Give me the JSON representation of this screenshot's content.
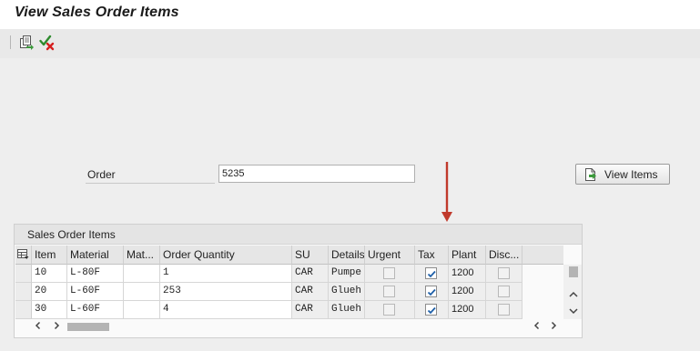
{
  "window": {
    "title": "View Sales Order Items"
  },
  "toolbar": {
    "icons": [
      "copy-document-icon",
      "check-cancel-icon"
    ]
  },
  "form": {
    "order_label": "Order",
    "order_value": "5235",
    "view_button_label": "View Items",
    "view_button_icon": "document-arrow-icon"
  },
  "annotation": {
    "arrow_color": "#c0392b"
  },
  "table": {
    "caption": "Sales Order Items",
    "columns": [
      "Item",
      "Material",
      "Mat...",
      "Order Quantity",
      "SU",
      "Details",
      "Urgent",
      "Tax",
      "Plant",
      "Disc..."
    ],
    "rows": [
      {
        "item": "10",
        "material": "L-80F",
        "mat_desc": "",
        "quantity": "1",
        "su": "CAR",
        "details": "Pumpe",
        "urgent": false,
        "tax": true,
        "plant": "1200",
        "disc": false
      },
      {
        "item": "20",
        "material": "L-60F",
        "mat_desc": "",
        "quantity": "253",
        "su": "CAR",
        "details": "Glueh",
        "urgent": false,
        "tax": true,
        "plant": "1200",
        "disc": false
      },
      {
        "item": "30",
        "material": "L-60F",
        "mat_desc": "",
        "quantity": "4",
        "su": "CAR",
        "details": "Glueh",
        "urgent": false,
        "tax": true,
        "plant": "1200",
        "disc": false
      }
    ]
  }
}
